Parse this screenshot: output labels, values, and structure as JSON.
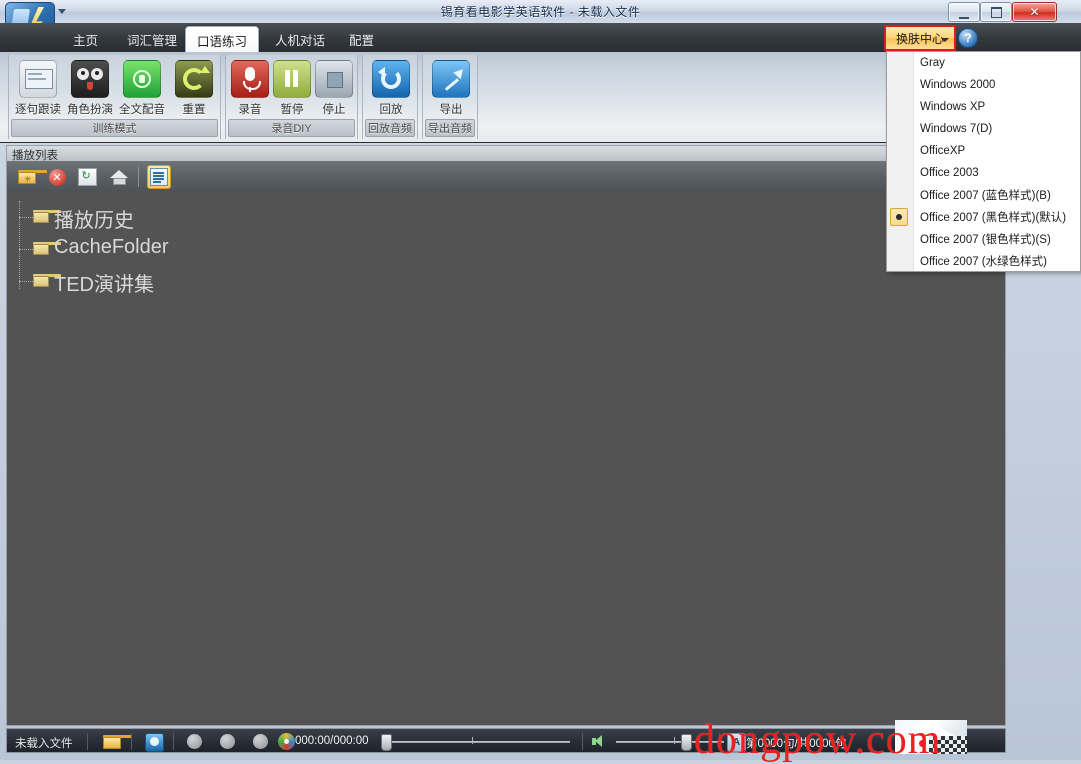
{
  "window": {
    "title": "锡育看电影学英语软件 - 未载入文件",
    "minimize_label": "",
    "maximize_label": "",
    "close_label": "✕"
  },
  "ribbon": {
    "tabs": [
      {
        "label": "主页",
        "active": false
      },
      {
        "label": "词汇管理",
        "active": false
      },
      {
        "label": "口语练习",
        "active": true
      },
      {
        "label": "人机对话",
        "active": false
      },
      {
        "label": "配置",
        "active": false
      }
    ],
    "skin_button": {
      "label": "换肤中心",
      "highlight_color": "#e01b1b"
    },
    "help_button": {
      "label": "?"
    },
    "groups": [
      {
        "title": "训练模式",
        "items": [
          {
            "label": "逐句跟读",
            "icon": "subtitle-icon",
            "has_caret": true
          },
          {
            "label": "角色扮演",
            "icon": "masks-icon",
            "has_caret": true
          },
          {
            "label": "全文配音",
            "icon": "dub-icon",
            "has_caret": true
          },
          {
            "label": "重置",
            "icon": "reset-icon",
            "has_caret": false
          }
        ]
      },
      {
        "title": "录音DIY",
        "items": [
          {
            "label": "录音",
            "icon": "microphone-icon",
            "has_caret": false
          },
          {
            "label": "暂停",
            "icon": "pause-icon",
            "has_caret": false
          },
          {
            "label": "停止",
            "icon": "stop-icon",
            "has_caret": false
          }
        ]
      },
      {
        "title": "回放音频",
        "items": [
          {
            "label": "回放",
            "icon": "replay-icon",
            "has_caret": false
          }
        ]
      },
      {
        "title": "导出音频",
        "items": [
          {
            "label": "导出",
            "icon": "export-icon",
            "has_caret": false
          }
        ]
      }
    ]
  },
  "playlist": {
    "header_label": "播放列表",
    "toolbar": [
      {
        "name": "new-folder-icon",
        "selected": false
      },
      {
        "name": "delete-icon",
        "selected": false
      },
      {
        "name": "refresh-icon",
        "selected": false
      },
      {
        "name": "home-icon",
        "selected": false
      },
      {
        "name": "list-view-icon",
        "selected": true
      }
    ],
    "tree": [
      {
        "label": "播放历史"
      },
      {
        "label": "CacheFolder"
      },
      {
        "label": "TED演讲集"
      }
    ]
  },
  "skin_menu": {
    "items": [
      {
        "label": "Gray",
        "checked": false
      },
      {
        "label": "Windows 2000",
        "checked": false
      },
      {
        "label": "Windows XP",
        "checked": false
      },
      {
        "label": "Windows 7(D)",
        "checked": false
      },
      {
        "label": "OfficeXP",
        "checked": false
      },
      {
        "label": "Office 2003",
        "checked": false
      },
      {
        "label": "Office 2007 (蓝色样式)(B)",
        "checked": false
      },
      {
        "label": "Office 2007 (黑色样式)(默认)",
        "checked": true
      },
      {
        "label": "Office 2007 (银色样式)(S)",
        "checked": false
      },
      {
        "label": "Office 2007 (水绿色样式)",
        "checked": false
      }
    ]
  },
  "statusbar": {
    "status_text": "未载入文件",
    "time_text": "000:00/000:00",
    "counter_text": "第0000句/共0000句"
  },
  "watermark": {
    "text": "dongpow.com"
  }
}
